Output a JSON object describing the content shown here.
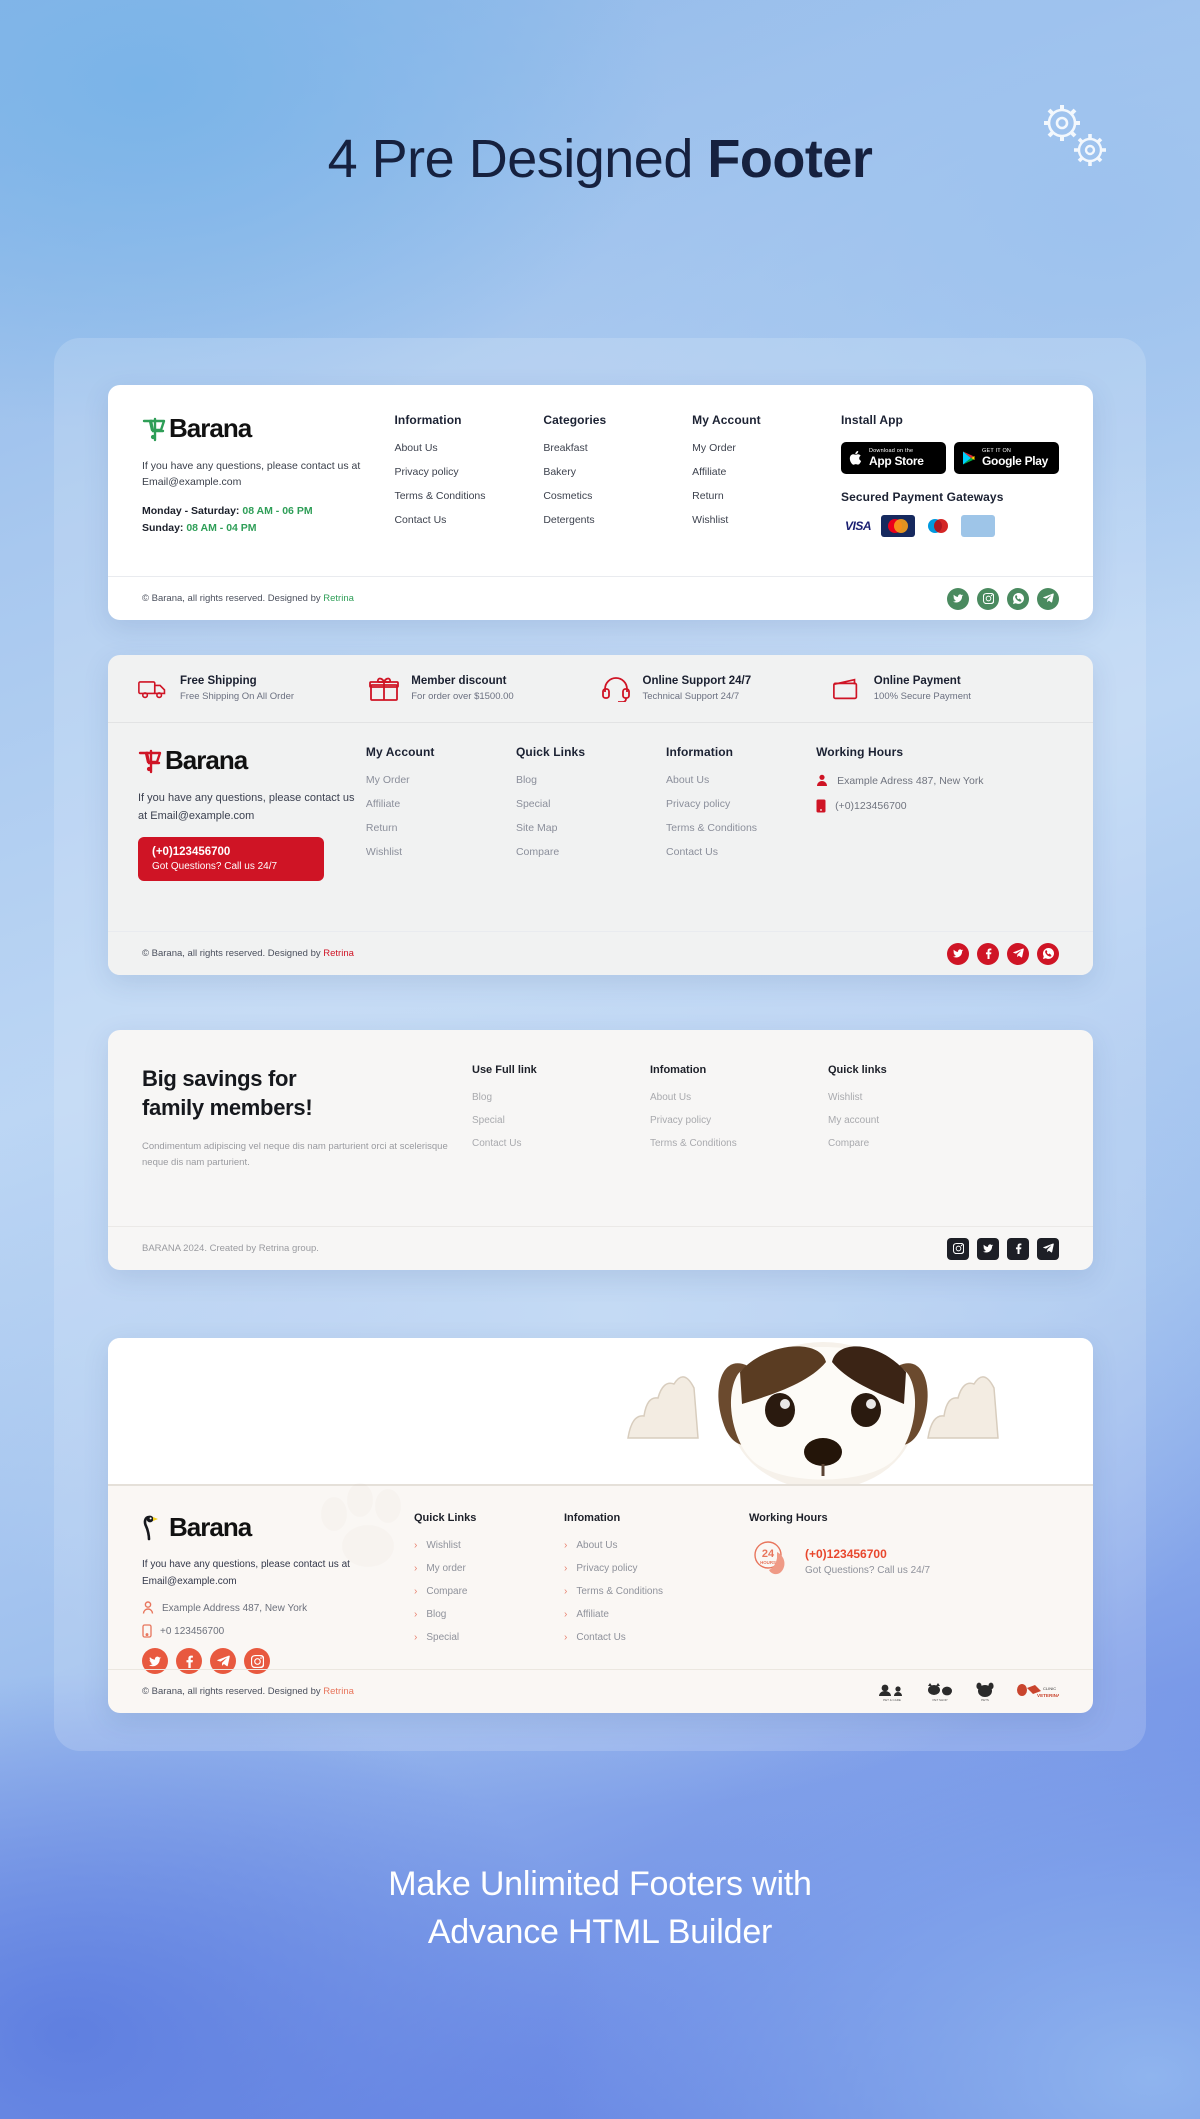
{
  "header": {
    "title_regular": "4 Pre Designed ",
    "title_bold": "Footer",
    "gear_icon": "gears-icon"
  },
  "caption": {
    "line1": "Make Unlimited Footers with",
    "line2": "Advance HTML Builder"
  },
  "colors": {
    "green": "#2e9e57",
    "red": "#cf1425",
    "coral": "#e8755c",
    "dark": "#16213f"
  },
  "footer1": {
    "logo": "Barana",
    "description": "If you have any questions, please contact us at Email@example.com",
    "hours_weekday_label": "Monday - Saturday:",
    "hours_weekday_value": " 08 AM - 06 PM",
    "hours_sunday_label": "Sunday:",
    "hours_sunday_value": " 08 AM - 04 PM",
    "columns": [
      {
        "head": "Information",
        "items": [
          "About Us",
          "Privacy policy",
          "Terms & Conditions",
          "Contact Us"
        ]
      },
      {
        "head": "Categories",
        "items": [
          "Breakfast",
          "Bakery",
          "Cosmetics",
          "Detergents"
        ]
      },
      {
        "head": "My Account",
        "items": [
          "My Order",
          "Affiliate",
          "Return",
          "Wishlist"
        ]
      }
    ],
    "install_head": "Install App",
    "appstore_small": "Download on the",
    "appstore_big": "App Store",
    "googleplay_small": "GET IT ON",
    "googleplay_big": "Google Play",
    "payment_head": "Secured Payment Gateways",
    "payments": [
      "VISA",
      "MasterCard",
      "Maestro",
      "American Express"
    ],
    "copyright_pre": "© Barana, all rights reserved. Designed by ",
    "copyright_brand": "Retrina",
    "socials": [
      "twitter-icon",
      "instagram-icon",
      "whatsapp-icon",
      "telegram-icon"
    ]
  },
  "footer2": {
    "features": [
      {
        "icon": "truck-icon",
        "title": "Free Shipping",
        "sub": "Free Shipping On All Order"
      },
      {
        "icon": "gift-icon",
        "title": "Member discount",
        "sub": "For order over $1500.00"
      },
      {
        "icon": "headset-icon",
        "title": "Online Support 24/7",
        "sub": "Technical Support 24/7"
      },
      {
        "icon": "wallet-icon",
        "title": "Online Payment",
        "sub": "100% Secure Payment"
      }
    ],
    "logo": "Barana",
    "description": "If you have any questions, please contact us at Email@example.com",
    "call_phone": "(+0)123456700",
    "call_sub": "Got Questions? Call us 24/7",
    "columns": [
      {
        "head": "My Account",
        "items": [
          "My Order",
          "Affiliate",
          "Return",
          "Wishlist"
        ]
      },
      {
        "head": "Quick Links",
        "items": [
          "Blog",
          "Special",
          "Site Map",
          "Compare"
        ]
      },
      {
        "head": "Information",
        "items": [
          "About Us",
          "Privacy policy",
          "Terms & Conditions",
          "Contact Us"
        ]
      }
    ],
    "hours_head": "Working Hours",
    "address": "Example Adress 487, New York",
    "phone": "(+0)123456700",
    "copyright_pre": "© Barana, all rights reserved. Designed by ",
    "copyright_brand": "Retrina",
    "socials": [
      "twitter-icon",
      "facebook-icon",
      "telegram-icon",
      "whatsapp-icon"
    ]
  },
  "footer3": {
    "title_line1": "Big savings for",
    "title_line2": "family members!",
    "description": "Condimentum adipiscing vel neque dis nam parturient orci at scelerisque neque dis nam parturient.",
    "columns": [
      {
        "head": "Use Full link",
        "items": [
          "Blog",
          "Special",
          "Contact Us"
        ]
      },
      {
        "head": "Infomation",
        "items": [
          "About Us",
          "Privacy policy",
          "Terms & Conditions"
        ]
      },
      {
        "head": "Quick links",
        "items": [
          "Wishlist",
          "My account",
          "Compare"
        ]
      }
    ],
    "copyright": "BARANA 2024. Created by Retrina group.",
    "socials": [
      "instagram-icon",
      "twitter-icon",
      "facebook-icon",
      "telegram-icon"
    ]
  },
  "footer4": {
    "logo": "Barana",
    "description": "If you have any questions, please contact us at Email@example.com",
    "address": "Example Address 487, New York",
    "phone": "+0 123456700",
    "socials": [
      "twitter-icon",
      "facebook-icon",
      "telegram-icon",
      "instagram-icon"
    ],
    "columns": [
      {
        "head": "Quick Links",
        "items": [
          "Wishlist",
          "My order",
          "Compare",
          "Blog",
          "Special"
        ]
      },
      {
        "head": "Infomation",
        "items": [
          "About Us",
          "Privacy policy",
          "Terms & Conditions",
          "Affiliate",
          "Contact Us"
        ]
      }
    ],
    "hours_head": "Working Hours",
    "badge_num": "24",
    "badge_text": "HOURS",
    "call_phone": "(+0)123456700",
    "call_sub": "Got Questions? Call us 24/7",
    "copyright_pre": "© Barana, all rights reserved. Designed by ",
    "copyright_brand": "Retrina",
    "partner_logos": [
      "pet-logo-1",
      "pet-logo-2",
      "pet-logo-3",
      "clinic-veterinary-logo"
    ]
  }
}
